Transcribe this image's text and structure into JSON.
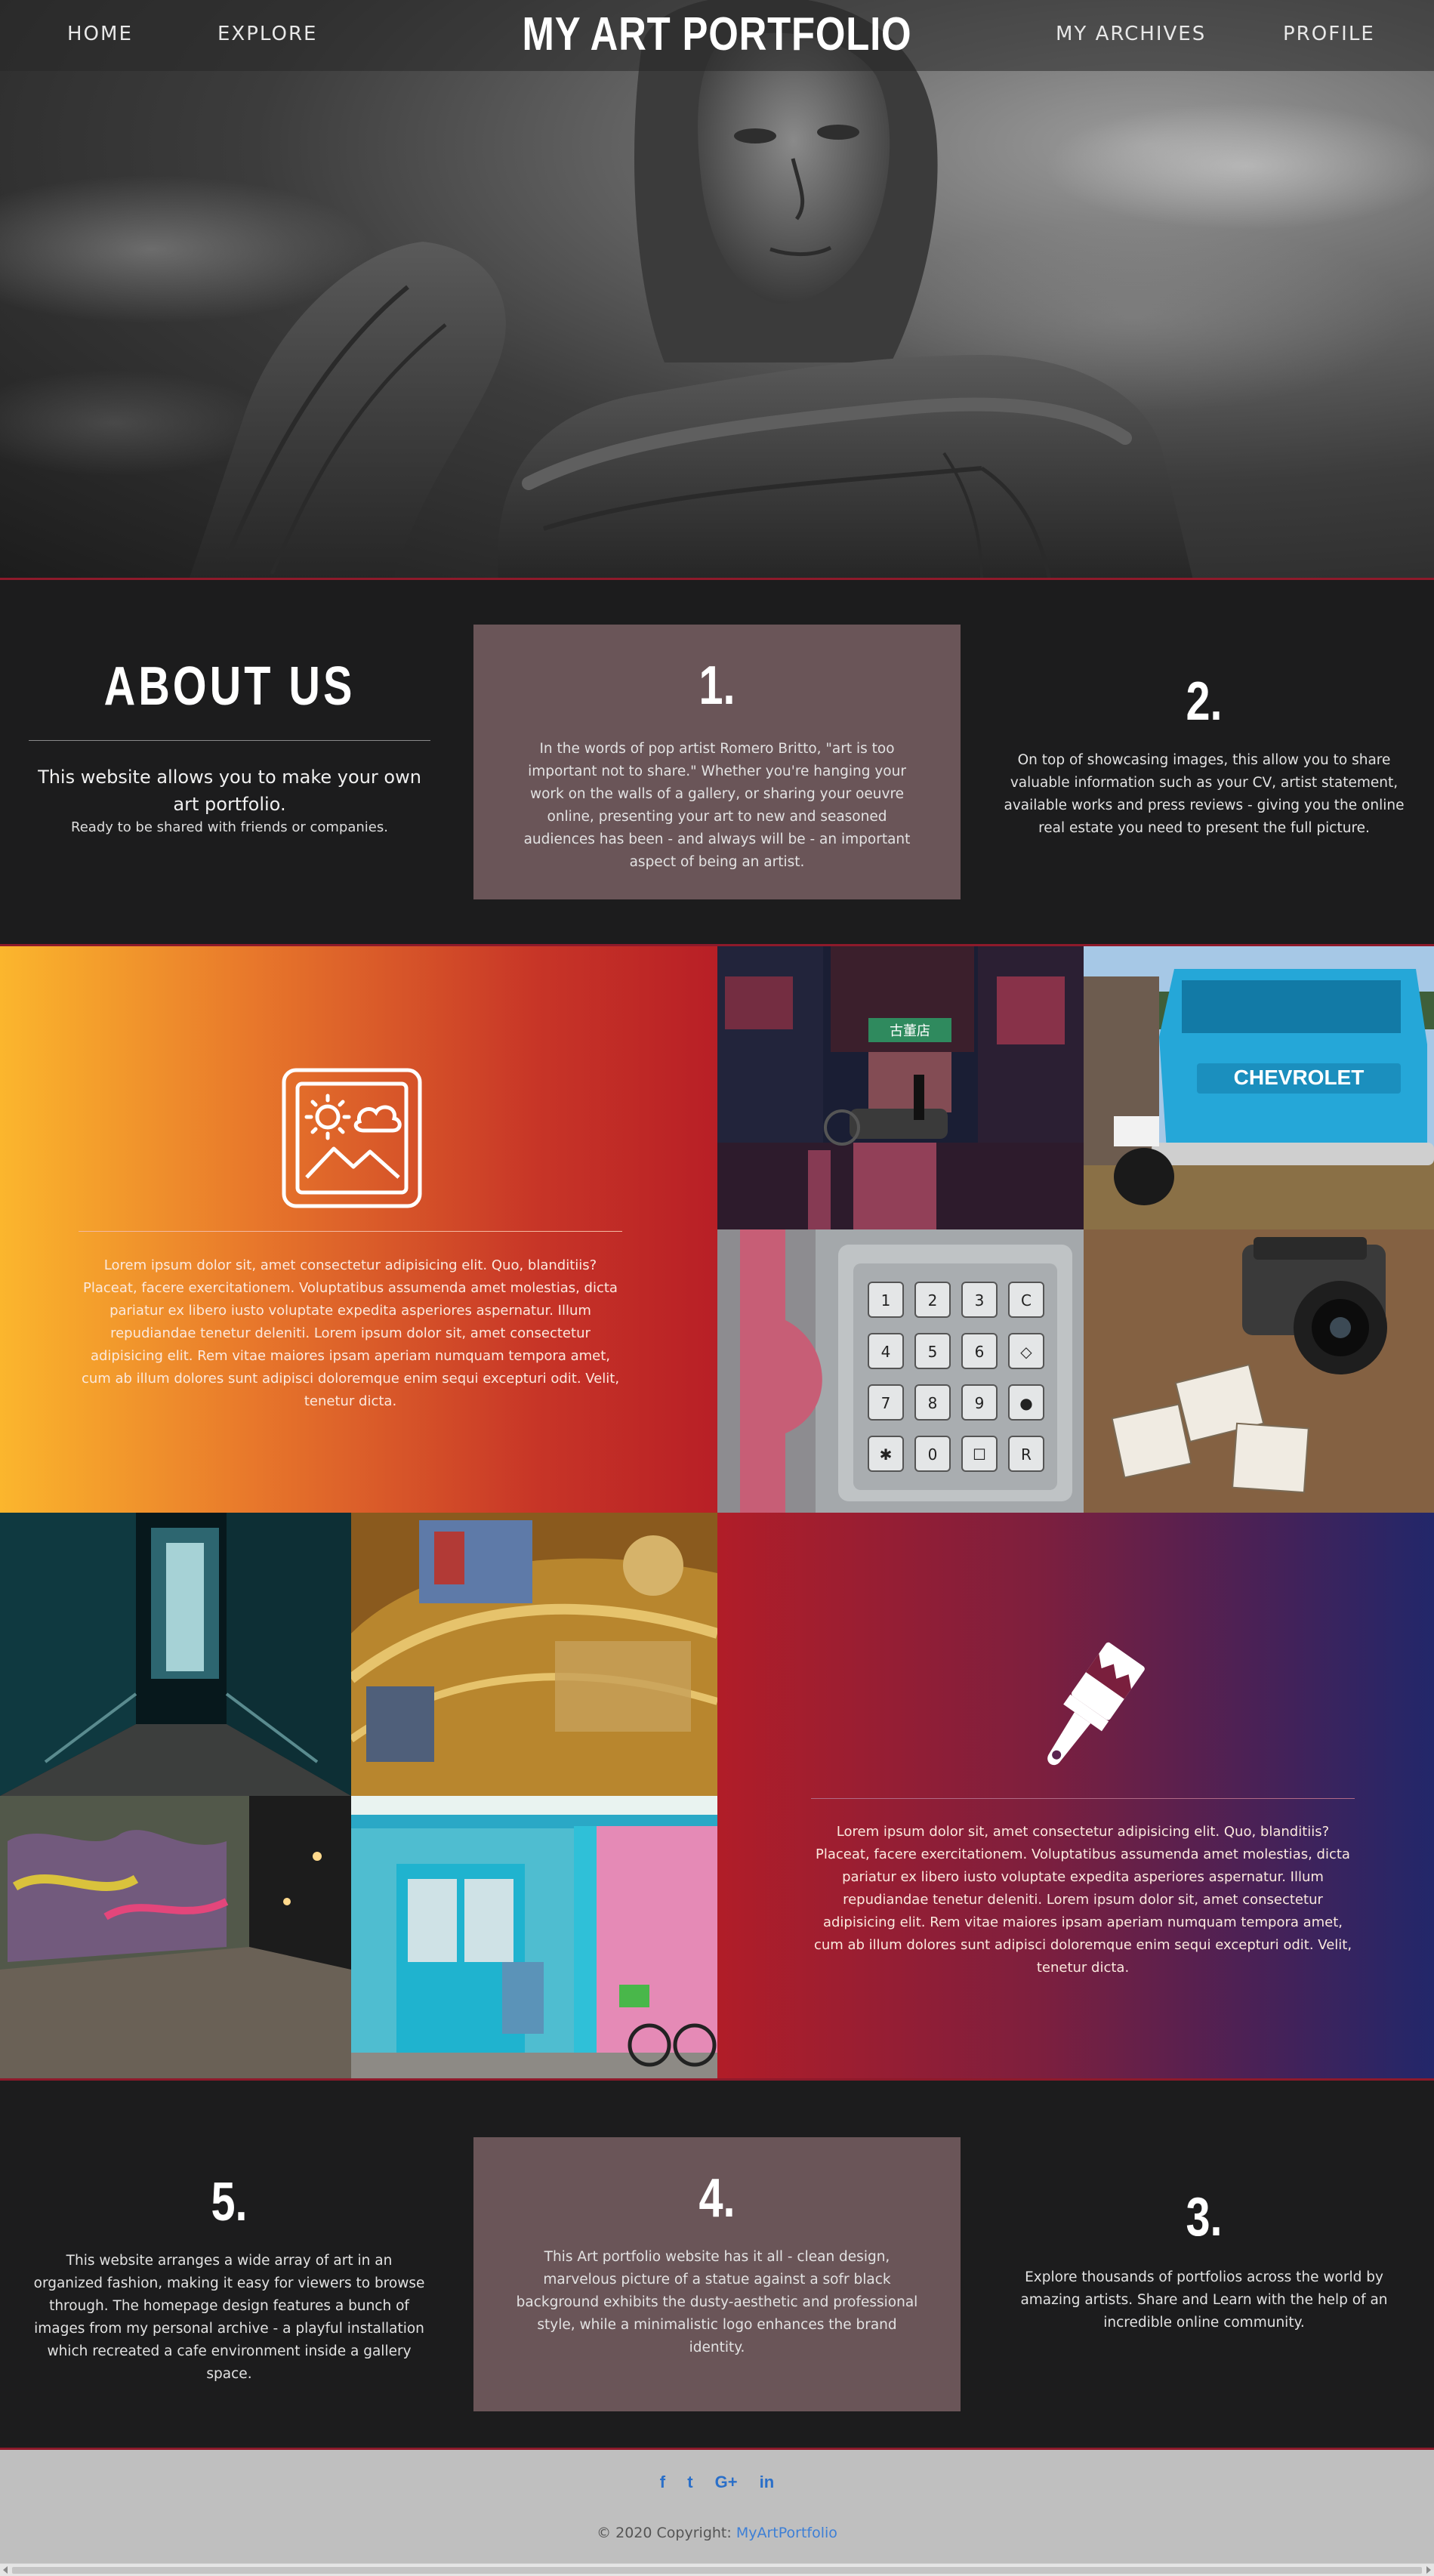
{
  "nav": {
    "brand": "MY ART PORTFOLIO",
    "home": "HOME",
    "explore": "EXPLORE",
    "archives": "MY ARCHIVES",
    "profile": "PROFILE"
  },
  "about": {
    "title": "ABOUT US",
    "subtitle": "This website allows you to make your own art portfolio.",
    "note": "Ready to be shared with friends or companies."
  },
  "points": {
    "p1": {
      "number": "1.",
      "text": "In the words of pop artist Romero Britto, \"art is too important not to share.\" Whether you're hanging your work on the walls of a gallery, or sharing your oeuvre online, presenting your art to new and seasoned audiences has been - and always will be - an important aspect of being an artist."
    },
    "p2": {
      "number": "2.",
      "text": "On top of showcasing images, this allow you to share valuable information such as your CV, artist statement, available works and press reviews - giving you the online real estate you need to present the full picture."
    },
    "p3": {
      "number": "3.",
      "text": "Explore thousands of portfolios across the world by amazing artists. Share and Learn with the help of an incredible online community."
    },
    "p4": {
      "number": "4.",
      "text": "This Art portfolio website has it all - clean design, marvelous picture of a statue against a sofr black background exhibits the dusty-aesthetic and professional style, while a minimalistic logo enhances the brand identity."
    },
    "p5": {
      "number": "5.",
      "text": "This website arranges a wide array of art in an organized fashion, making it easy for viewers to browse through. The homepage design features a bunch of images from my personal archive - a playful installation which recreated a cafe environment inside a gallery space."
    }
  },
  "gallery": {
    "lorem": "Lorem ipsum dolor sit, amet consectetur adipisicing elit. Quo, blanditiis? Placeat, facere exercitationem. Voluptatibus assumenda amet molestias, dicta pariatur ex libero iusto voluptate expedita asperiores aspernatur. Illum repudiandae tenetur deleniti. Lorem ipsum dolor sit, amet consectetur adipisicing elit. Rem vitae maiores ipsam aperiam numquam tempora amet, cum ab illum dolores sunt adipisci doloremque enim sequi excepturi odit. Velit, tenetur dicta.",
    "lorem2": "Lorem ipsum dolor sit, amet consectetur adipisicing elit. Quo, blanditiis? Placeat, facere exercitationem. Voluptatibus assumenda amet molestias, dicta pariatur ex libero iusto voluptate expedita asperiores aspernatur. Illum repudiandae tenetur deleniti. Lorem ipsum dolor sit, amet consectetur adipisicing elit. Rem vitae maiores ipsam aperiam numquam tempora amet, cum ab illum dolores sunt adipisci doloremque enim sequi excepturi odit. Velit, tenetur dicta.",
    "truck_plate": "CHEVROLET",
    "neon_sign": "古董店",
    "keypad": [
      "1",
      "2",
      "3",
      "C",
      "4",
      "5",
      "6",
      "◇",
      "7",
      "8",
      "9",
      "●",
      "✱",
      "0",
      "☐",
      "R"
    ]
  },
  "footer": {
    "social": [
      "f",
      "t",
      "G+",
      "in"
    ],
    "copyright": "© 2020 Copyright:",
    "site": "MyArtPortfolio"
  },
  "icons": {
    "image": "image-icon",
    "brush": "paint-brush-icon",
    "facebook": "facebook-icon",
    "twitter": "twitter-icon",
    "google": "google-plus-icon",
    "linkedin": "linkedin-icon"
  },
  "colors": {
    "accent_red": "#8e1a2b",
    "card": "#6a5558",
    "link": "#3d7fd6"
  }
}
